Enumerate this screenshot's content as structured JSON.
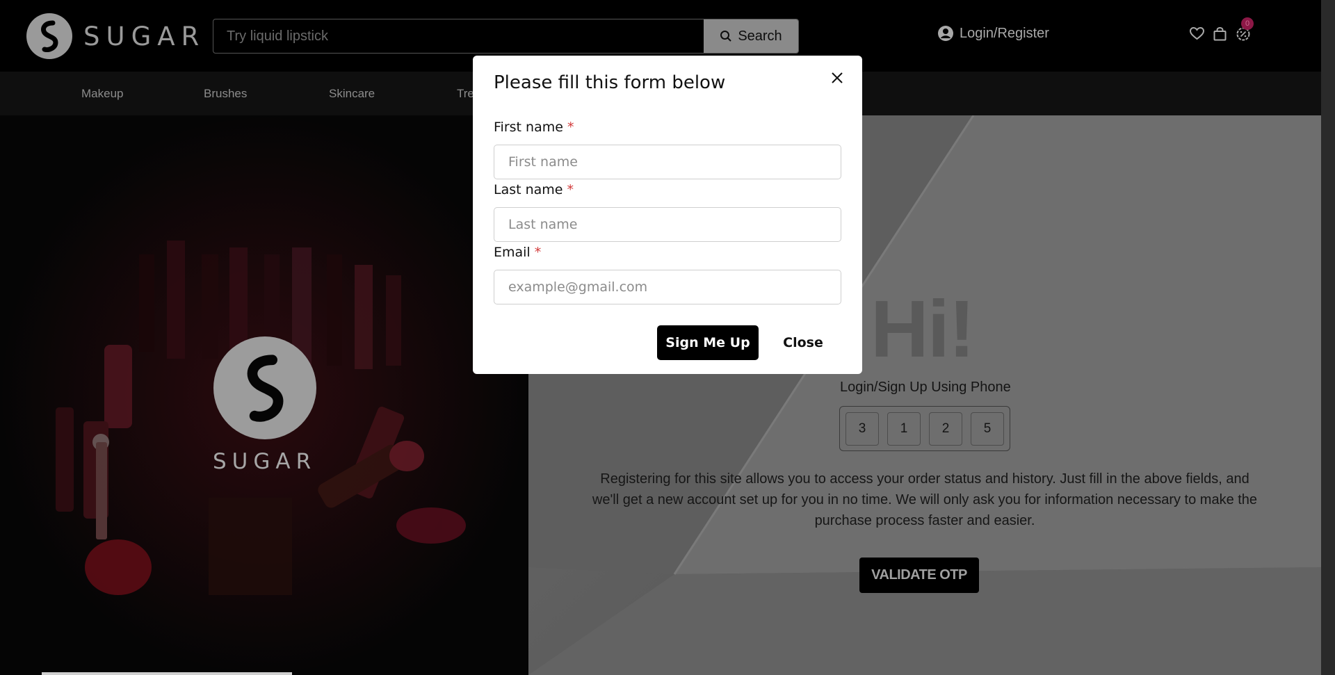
{
  "brand": {
    "name": "SUGAR"
  },
  "search": {
    "placeholder": "Try liquid lipstick",
    "button_label": "Search"
  },
  "account": {
    "login_label": "Login/Register"
  },
  "cart": {
    "badge_count": "0"
  },
  "nav": {
    "items": [
      "Makeup",
      "Brushes",
      "Skincare",
      "Tre"
    ]
  },
  "login_panel": {
    "greeting": "Hi!",
    "phone_label": "Login/Sign Up Using Phone",
    "otp_digits": [
      "3",
      "1",
      "2",
      "5"
    ],
    "description": "Registering for this site allows you to access your order status and history. Just fill in the above fields, and we'll get a new account set up for you in no time. We will only ask you for information necessary to make the purchase process faster and easier.",
    "validate_label": "VALIDATE OTP"
  },
  "modal": {
    "title": "Please fill this form below",
    "first_name": {
      "label": "First name",
      "placeholder": "First name"
    },
    "last_name": {
      "label": "Last name",
      "placeholder": "Last name"
    },
    "email": {
      "label": "Email",
      "placeholder": "example@gmail.com"
    },
    "required_mark": "*",
    "submit_label": "Sign Me Up",
    "close_label": "Close"
  },
  "colors": {
    "overlay_header": "#000000",
    "modal_bg": "#ffffff",
    "primary_button": "#000000",
    "required": "#d23a3a",
    "badge": "#8c1846"
  }
}
